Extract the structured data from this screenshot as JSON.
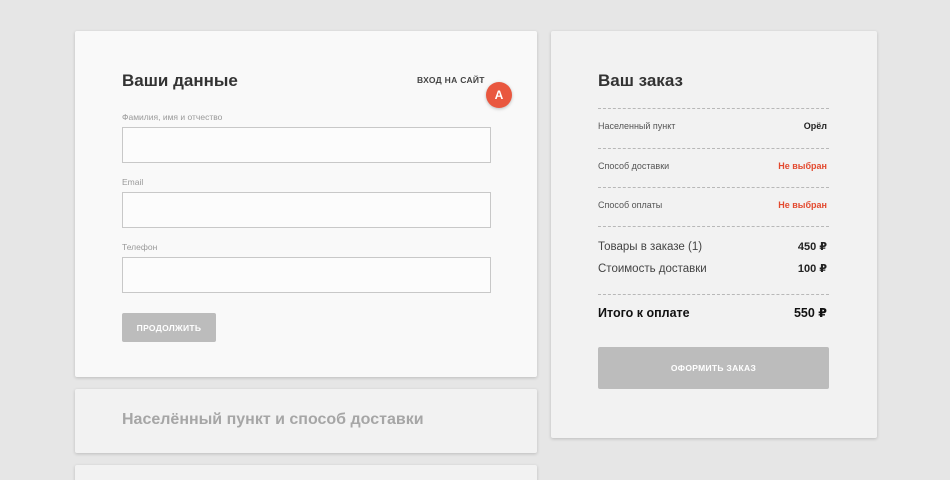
{
  "details": {
    "title": "Ваши данные",
    "login_link": "ВХОД НА САЙТ",
    "login_chevron": "›",
    "marker": "A",
    "fields": [
      {
        "label": "Фамилия, имя и отчество",
        "value": "",
        "placeholder": ""
      },
      {
        "label": "Email",
        "value": "",
        "placeholder": ""
      },
      {
        "label": "Телефон",
        "value": "",
        "placeholder": ""
      }
    ],
    "continue_label": "ПРОДОЛЖИТЬ"
  },
  "delivery": {
    "title": "Населённый пункт и способ доставки"
  },
  "order": {
    "title": "Ваш заказ",
    "settings": [
      {
        "label": "Населенный пункт",
        "value": "Орёл"
      },
      {
        "label": "Способ доставки",
        "value": "Не выбран"
      },
      {
        "label": "Способ оплаты",
        "value": "Не выбран"
      }
    ],
    "costs": [
      {
        "label": "Товары в заказе (1)",
        "value": "450 ₽"
      },
      {
        "label": "Стоимость доставки",
        "value": "100 ₽"
      }
    ],
    "total": {
      "label": "Итого к оплате",
      "value": "550 ₽"
    },
    "checkout_label": "ОФОРМИТЬ ЗАКАЗ"
  },
  "colors": {
    "accent_marker": "#e9573f",
    "warning_text": "#e34a2f",
    "disabled_button": "#bcbcbc",
    "background": "#e6e6e6"
  }
}
